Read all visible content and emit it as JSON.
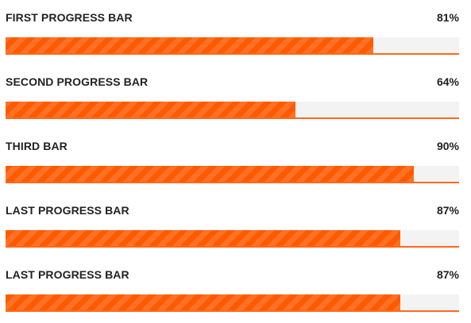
{
  "accent_color": "#ff5a00",
  "track_color": "#f3f3f3",
  "progress_bars": [
    {
      "label": "FIRST PROGRESS BAR",
      "percent_text": "81%",
      "value": 81
    },
    {
      "label": "SECOND PROGRESS BAR",
      "percent_text": "64%",
      "value": 64
    },
    {
      "label": "THIRD BAR",
      "percent_text": "90%",
      "value": 90
    },
    {
      "label": "LAST PROGRESS BAR",
      "percent_text": "87%",
      "value": 87
    },
    {
      "label": "LAST PROGRESS BAR",
      "percent_text": "87%",
      "value": 87
    }
  ]
}
